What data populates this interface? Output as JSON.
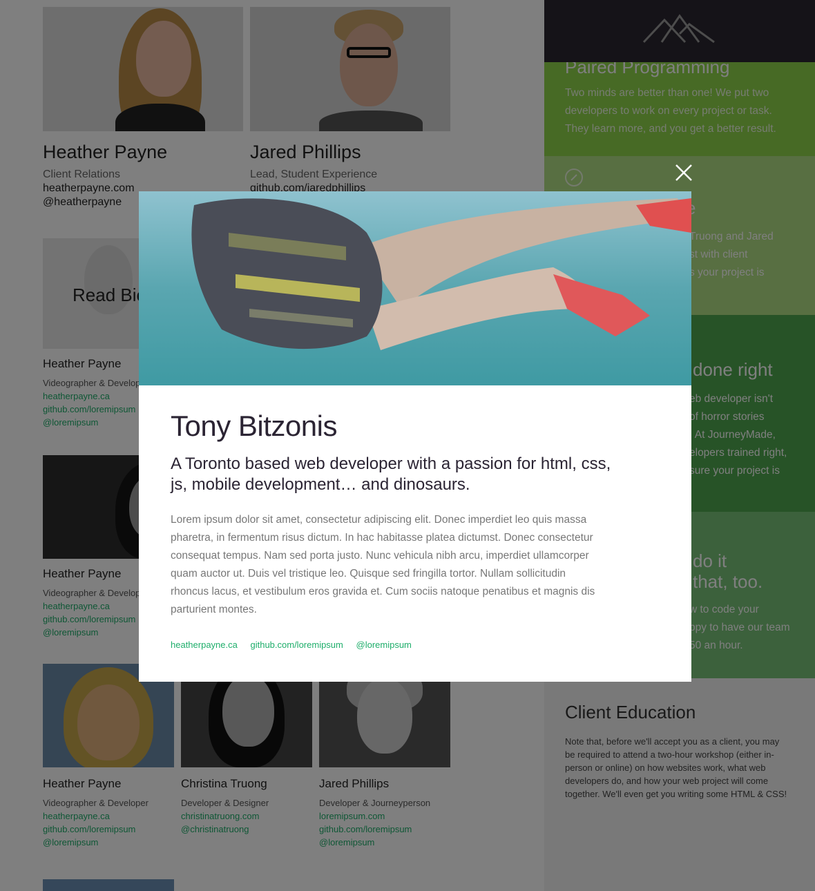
{
  "team": {
    "featured": [
      {
        "name": "Heather Payne",
        "role": "Client Relations",
        "links": [
          "heatherpayne.com",
          "@heatherpayne"
        ]
      },
      {
        "name": "Jared Phillips",
        "role": "Lead, Student Experience",
        "links": [
          "github.com/jaredphillips"
        ]
      }
    ],
    "read_bio": "Read Bio",
    "rows": [
      [
        {
          "name": "Heather Payne",
          "role": "Videographer & Developer",
          "links": [
            "heatherpayne.ca",
            "github.com/loremipsum",
            "@loremipsum"
          ]
        }
      ],
      [
        {
          "name": "Heather Payne",
          "role": "Videographer & Developer",
          "links": [
            "heatherpayne.ca",
            "github.com/loremipsum",
            "@loremipsum"
          ]
        }
      ],
      [
        {
          "name": "Heather Payne",
          "role": "Videographer & Developer",
          "links": [
            "heatherpayne.ca",
            "github.com/loremipsum",
            "@loremipsum"
          ]
        },
        {
          "name": "Christina Truong",
          "role": "Developer & Designer",
          "links": [
            "christinatruong.com",
            "@christinatruong"
          ]
        },
        {
          "name": "Jared Phillips",
          "role": "Developer & Journeyperson",
          "links": [
            "loremipsum.com",
            "github.com/loremipsum",
            "@loremipsum"
          ]
        }
      ]
    ]
  },
  "sidebar": {
    "logo_icon": "mountains-logo-icon",
    "sections": [
      {
        "title": "Paired Programming",
        "body": "Two minds are better than one! We put two developers to work on every project or task. They learn more, and you get a better result.",
        "color": "#8ed44a"
      },
      {
        "title_fragment": "e",
        "icon": "compass-icon",
        "body_fragments": [
          "Truong and Jared",
          "st with client",
          "s your project is"
        ],
        "color": "#b1de84"
      },
      {
        "title_fragment": "done right",
        "body_fragments": [
          "eb developer isn't",
          "of horror stories",
          ". At JourneyMade,",
          "elopers trained right,",
          "sure your project is"
        ],
        "color": "#4fa64f"
      },
      {
        "title_fragments": [
          "do it",
          "that, too."
        ],
        "body_fragments": [
          "w to code your",
          "ppy to have our team",
          "50 an hour."
        ],
        "color": "#79c279"
      },
      {
        "title": "Client Education",
        "body": "Note that, before we'll accept you as a client, you may be required to attend a two-hour workshop (either in-person or online) on how websites work, what web developers do, and how your web project will come together. We'll even get you writing some HTML & CSS!"
      }
    ]
  },
  "modal": {
    "close_icon": "close-icon",
    "name": "Tony Bitzonis",
    "tagline": "A Toronto based web developer with a passion for html, css, js, mobile development… and dinosaurs.",
    "bio": "Lorem ipsum dolor sit amet, consectetur adipiscing elit. Donec imperdiet leo quis massa pharetra, in fermentum risus dictum. In hac habitasse platea dictumst. Donec consectetur consequat tempus. Nam sed porta justo. Nunc vehicula nibh arcu, imperdiet ullamcorper quam auctor ut. Duis vel tristique leo. Quisque sed fringilla tortor. Nullam sollicitudin rhoncus lacus, et vestibulum eros gravida et. Cum sociis natoque penatibus et magnis dis parturient montes.",
    "links": [
      "heatherpayne.ca",
      "github.com/loremipsum",
      "@loremipsum"
    ]
  },
  "colors": {
    "accent_green": "#1fae6b",
    "sidebar_dark": "#2a2630",
    "modal_heading": "#2b2433"
  }
}
